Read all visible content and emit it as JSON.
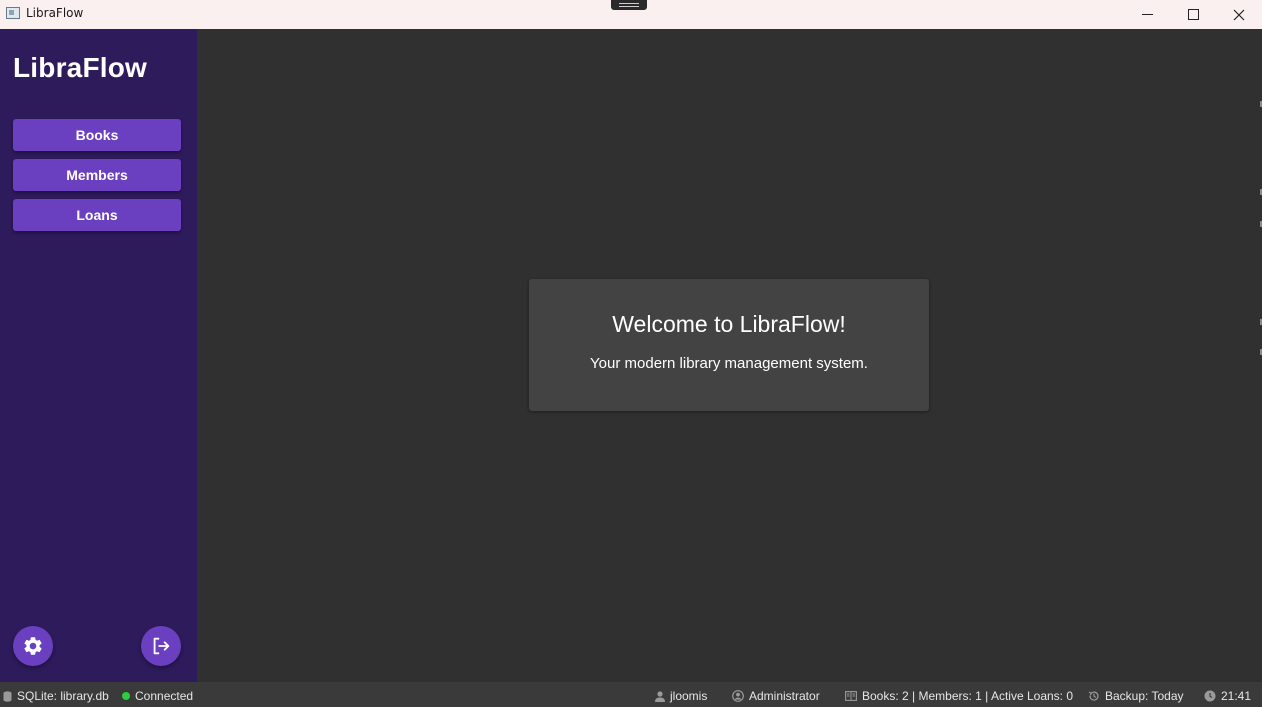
{
  "window": {
    "title": "LibraFlow"
  },
  "sidebar": {
    "brand": "LibraFlow",
    "nav": [
      {
        "label": "Books"
      },
      {
        "label": "Members"
      },
      {
        "label": "Loans"
      }
    ],
    "settings_icon": "gear-icon",
    "logout_icon": "logout-icon"
  },
  "main": {
    "welcome_title": "Welcome to LibraFlow!",
    "welcome_subtitle": "Your modern library management system."
  },
  "statusbar": {
    "database": "SQLite: library.db",
    "connection": "Connected",
    "user": "jloomis",
    "role": "Administrator",
    "stats": "Books: 2 | Members: 1 | Active Loans: 0",
    "backup": "Backup: Today",
    "time": "21:41"
  },
  "colors": {
    "sidebar_bg": "#2e1b5c",
    "accent": "#6a3fc0",
    "main_bg": "#303030",
    "card_bg": "#434343",
    "statusbar_bg": "#3a3a3a",
    "connected": "#2ecc40"
  }
}
